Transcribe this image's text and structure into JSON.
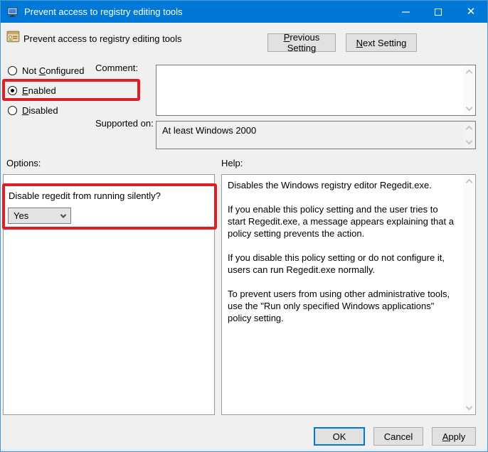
{
  "titlebar": {
    "title": "Prevent access to registry editing tools"
  },
  "header": {
    "title": "Prevent access to registry editing tools",
    "previous_setting": {
      "accel": "P",
      "rest": "revious Setting"
    },
    "next_setting": {
      "accel": "N",
      "rest": "ext Setting"
    }
  },
  "radios": {
    "not_configured": {
      "pre": "Not ",
      "accel": "C",
      "post": "onfigured",
      "selected": false
    },
    "enabled": {
      "pre": "",
      "accel": "E",
      "post": "nabled",
      "selected": true
    },
    "disabled": {
      "pre": "",
      "accel": "D",
      "post": "isabled",
      "selected": false
    }
  },
  "comment": {
    "label": "Comment:",
    "value": ""
  },
  "supported": {
    "label": "Supported on:",
    "value": "At least Windows 2000"
  },
  "options": {
    "label": "Options:",
    "question": "Disable regedit from running silently?",
    "dropdown_value": "Yes"
  },
  "help": {
    "label": "Help:",
    "paragraphs": [
      "Disables the Windows registry editor Regedit.exe.",
      "If you enable this policy setting and the user tries to start Regedit.exe, a message appears explaining that a policy setting prevents the action.",
      "If you disable this policy setting or do not configure it, users can run Regedit.exe normally.",
      "To prevent users from using other administrative tools, use the \"Run only specified Windows applications\" policy setting."
    ]
  },
  "footer": {
    "ok": "OK",
    "cancel": "Cancel",
    "apply": {
      "accel": "A",
      "rest": "pply"
    }
  },
  "colors": {
    "titlebar_bg": "#0078d7",
    "dialog_bg": "#f0f0f0",
    "annotation_red": "#e01e25",
    "default_button_border": "#0078d7",
    "button_bg": "#e1e1e1",
    "button_border": "#adadad"
  },
  "icons": {
    "titlebar_app": "computer-monitor-icon",
    "header_policy": "policy-document-icon",
    "minimize": "minimize-dash",
    "maximize": "maximize-square",
    "close": "close-x",
    "dropdown": "chevron-down",
    "scroll_up": "chevron-up",
    "scroll_down": "chevron-down"
  }
}
